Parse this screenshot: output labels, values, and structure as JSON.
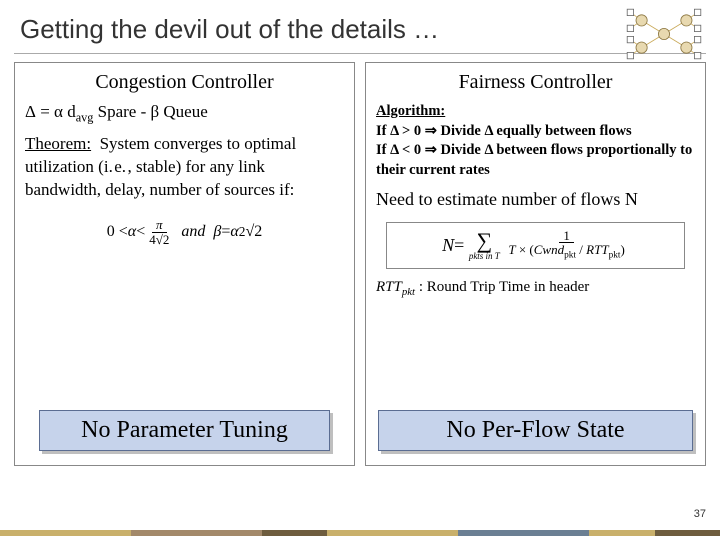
{
  "title": "Getting the devil out of the details …",
  "left": {
    "heading": "Congestion Controller",
    "delta_eq": "Δ = α davg Spare - β Queue",
    "theorem_label": "Theorem:",
    "theorem_body": "System converges to optimal utilization (i. e. , stable) for any link bandwidth, delay, number of sources if:",
    "math": "0 < α < π / (4√2)   and   β = α² √2",
    "badge": "No Parameter Tuning"
  },
  "right": {
    "heading": "Fairness Controller",
    "algo_label": "Algorithm:",
    "algo_line1": "If Δ > 0 ⇒ Divide Δ equally between flows",
    "algo_line2": "If Δ < 0 ⇒ Divide Δ between flows proportionally to their current rates",
    "need": "Need to estimate number of flows N",
    "N_lhs": "N = ",
    "N_sum": "∑",
    "N_sum_sub": "pkts in T",
    "N_frac_top": "1",
    "N_frac_bot": "T × (Cwndpkt / RTTpkt)",
    "rtt_note_sym": "RTTpkt",
    "rtt_note_rest": " : Round Trip Time in header",
    "badge": "No Per-Flow State"
  },
  "page_number": "37",
  "footer_colors": [
    "#c9b06b",
    "#a3896a",
    "#6e5d3e",
    "#c9b06b",
    "#6b7f93",
    "#c9b06b",
    "#6e5d3e"
  ]
}
